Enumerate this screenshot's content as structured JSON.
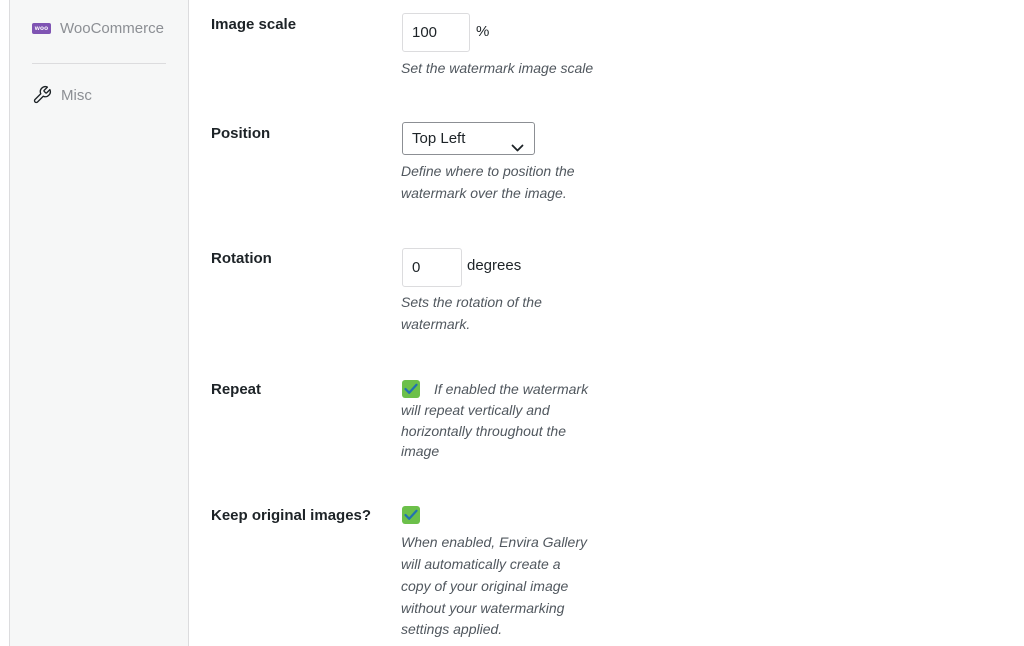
{
  "sidebar": {
    "items": [
      {
        "label": "WooCommerce",
        "icon": "woocommerce-icon",
        "badge_text": "woo"
      },
      {
        "label": "Misc",
        "icon": "wrench-icon"
      }
    ]
  },
  "settings": {
    "image_scale": {
      "label": "Image scale",
      "value": "100",
      "unit": "%",
      "description": "Set the watermark image scale"
    },
    "position": {
      "label": "Position",
      "selected": "Top Left",
      "description_lines": [
        "Define where to position the",
        "watermark over the image."
      ]
    },
    "rotation": {
      "label": "Rotation",
      "value": "0",
      "unit": "degrees",
      "description_lines": [
        "Sets the rotation of the",
        "watermark."
      ]
    },
    "repeat": {
      "label": "Repeat",
      "checked": true,
      "description_lines": [
        "If enabled the watermark",
        "will repeat vertically and",
        "horizontally throughout the",
        "image"
      ]
    },
    "keep_original": {
      "label": "Keep original images?",
      "checked": true,
      "description_lines": [
        "When enabled, Envira Gallery",
        "will automatically create a",
        "copy of your original image",
        "without your watermarking",
        "settings applied."
      ]
    }
  },
  "colors": {
    "checkbox_checked": "#6cc04a",
    "checkmark": "#2271b1",
    "woo_brand": "#7f54b3"
  }
}
